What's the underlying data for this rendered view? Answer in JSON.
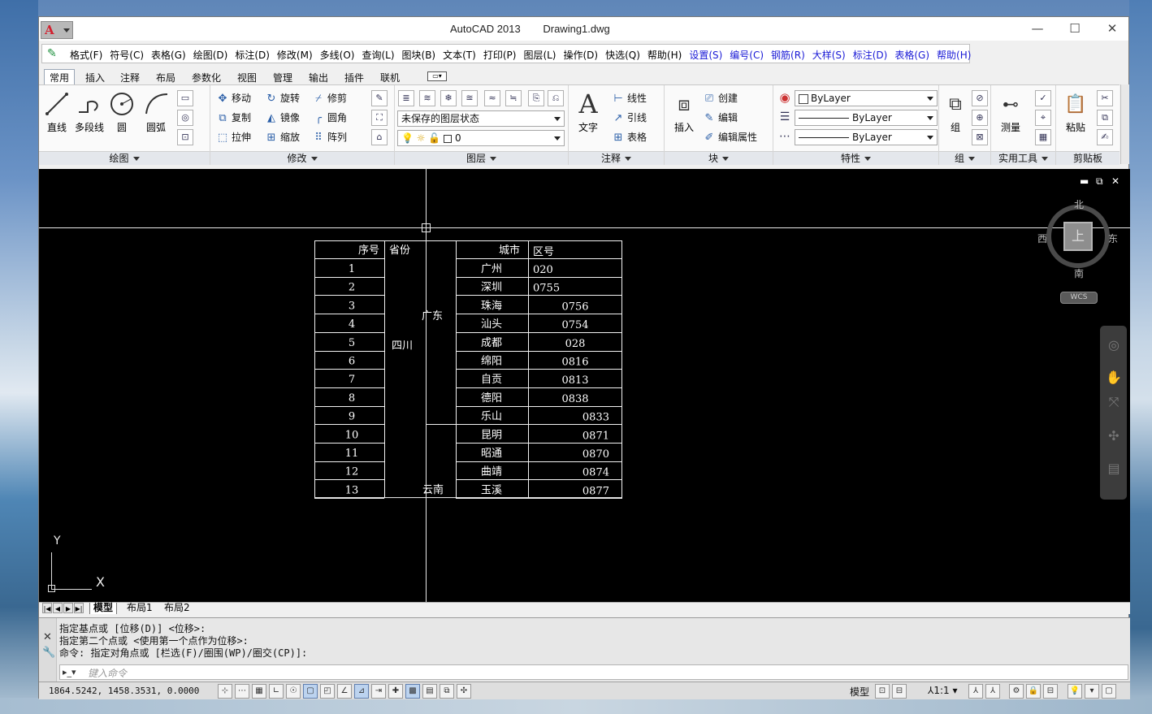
{
  "window": {
    "app_title": "AutoCAD 2013",
    "file_title": "Drawing1.dwg",
    "minimize": "—",
    "maximize": "☐",
    "close": "✕"
  },
  "menubar": {
    "items": [
      {
        "label": "格式(F)",
        "color": "black"
      },
      {
        "label": "符号(C)",
        "color": "black"
      },
      {
        "label": "表格(G)",
        "color": "black"
      },
      {
        "label": "绘图(D)",
        "color": "black"
      },
      {
        "label": "标注(D)",
        "color": "black"
      },
      {
        "label": "修改(M)",
        "color": "black"
      },
      {
        "label": "多线(O)",
        "color": "black"
      },
      {
        "label": "查询(L)",
        "color": "black"
      },
      {
        "label": "图块(B)",
        "color": "black"
      },
      {
        "label": "文本(T)",
        "color": "black"
      },
      {
        "label": "打印(P)",
        "color": "black"
      },
      {
        "label": "图层(L)",
        "color": "black"
      },
      {
        "label": "操作(D)",
        "color": "black"
      },
      {
        "label": "快选(Q)",
        "color": "black"
      },
      {
        "label": "帮助(H)",
        "color": "black"
      },
      {
        "label": "设置(S)",
        "color": "blue"
      },
      {
        "label": "编号(C)",
        "color": "blue"
      },
      {
        "label": "钢筋(R)",
        "color": "blue"
      },
      {
        "label": "大样(S)",
        "color": "blue"
      },
      {
        "label": "标注(D)",
        "color": "blue"
      },
      {
        "label": "表格(G)",
        "color": "blue"
      },
      {
        "label": "帮助(H)",
        "color": "blue"
      }
    ]
  },
  "ribbon_tabs": [
    "常用",
    "插入",
    "注释",
    "布局",
    "参数化",
    "视图",
    "管理",
    "输出",
    "插件",
    "联机"
  ],
  "ribbon": {
    "draw": {
      "title": "绘图",
      "line": "直线",
      "polyline": "多段线",
      "circle": "圆",
      "arc": "圆弧"
    },
    "modify": {
      "title": "修改",
      "move": "移动",
      "rotate": "旋转",
      "trim": "修剪",
      "copy": "复制",
      "mirror": "镜像",
      "fillet": "圆角",
      "stretch": "拉伸",
      "scale": "缩放",
      "array": "阵列"
    },
    "layers": {
      "title": "图层",
      "state": "未保存的图层状态",
      "current": "0"
    },
    "annotation": {
      "title": "注释",
      "text": "文字",
      "linear": "线性",
      "leader": "引线",
      "table": "表格"
    },
    "block": {
      "title": "块",
      "insert": "插入",
      "create": "创建",
      "edit": "编辑",
      "edit_attr": "编辑属性"
    },
    "properties": {
      "title": "特性",
      "color": "ByLayer",
      "linetype": "ByLayer",
      "lineweight": "ByLayer"
    },
    "groups": {
      "title": "组",
      "group": "组"
    },
    "utilities": {
      "title": "实用工具",
      "measure": "测量"
    },
    "clipboard": {
      "title": "剪贴板",
      "paste": "粘贴"
    }
  },
  "viewcube": {
    "north": "北",
    "south": "南",
    "east": "东",
    "west": "西",
    "top": "上",
    "wcs": "WCS"
  },
  "table": {
    "headers": [
      "序号",
      "省份",
      "城市",
      "区号"
    ],
    "provinces": [
      "广东",
      "四川",
      "云南"
    ],
    "rows": [
      {
        "no": "1",
        "city": "广州",
        "code": "020"
      },
      {
        "no": "2",
        "city": "深圳",
        "code": "0755"
      },
      {
        "no": "3",
        "city": "珠海",
        "code": "0756"
      },
      {
        "no": "4",
        "city": "汕头",
        "code": "0754"
      },
      {
        "no": "5",
        "city": "成都",
        "code": "028"
      },
      {
        "no": "6",
        "city": "绵阳",
        "code": "0816"
      },
      {
        "no": "7",
        "city": "自贡",
        "code": "0813"
      },
      {
        "no": "8",
        "city": "德阳",
        "code": "0838"
      },
      {
        "no": "9",
        "city": "乐山",
        "code": "0833"
      },
      {
        "no": "10",
        "city": "昆明",
        "code": "0871"
      },
      {
        "no": "11",
        "city": "昭通",
        "code": "0870"
      },
      {
        "no": "12",
        "city": "曲靖",
        "code": "0874"
      },
      {
        "no": "13",
        "city": "玉溪",
        "code": "0877"
      }
    ]
  },
  "ucs": {
    "x": "X",
    "y": "Y"
  },
  "layout_tabs": [
    "模型",
    "布局1",
    "布局2"
  ],
  "command": {
    "history": [
      "指定基点或 [位移(D)] <位移>:",
      "指定第二个点或 <使用第一个点作为位移>:",
      "命令: 指定对角点或 [栏选(F)/圈围(WP)/圈交(CP)]:"
    ],
    "placeholder": "键入命令"
  },
  "status": {
    "coords": "1864.5242, 1458.3531, 0.0000",
    "model": "模型",
    "scale": "1:1"
  }
}
